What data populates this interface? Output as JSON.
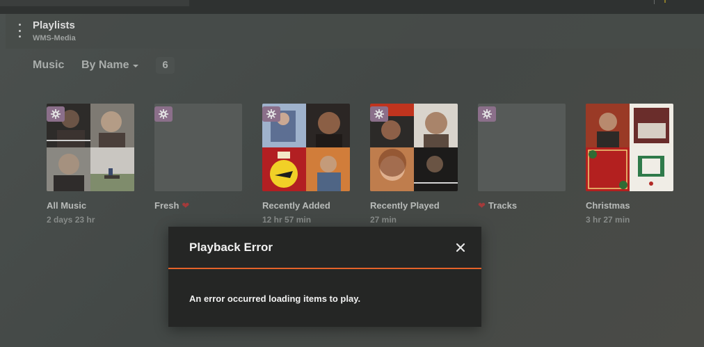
{
  "header": {
    "title": "Playlists",
    "subtitle": "WMS-Media"
  },
  "filter": {
    "section": "Music",
    "sort": "By Name",
    "count": "6"
  },
  "playlists": [
    {
      "title": "All Music",
      "subtitle": "2 days 23 hr",
      "art": "collage"
    },
    {
      "title": "Fresh",
      "subtitle": "",
      "art": "empty",
      "heart": "after"
    },
    {
      "title": "Recently Added",
      "subtitle": "12 hr 57 min",
      "art": "collage"
    },
    {
      "title": "Recently Played",
      "subtitle": "27 min",
      "art": "collage"
    },
    {
      "title": "Tracks",
      "subtitle": "",
      "art": "empty",
      "heart": "before"
    },
    {
      "title": "Christmas",
      "subtitle": "3 hr 27 min",
      "art": "collage"
    }
  ],
  "dialog": {
    "title": "Playback Error",
    "message": "An error occurred loading items to play."
  },
  "icons": {
    "menu": "more-vertical-icon",
    "smart": "gear-icon",
    "heart": "heart-icon",
    "close": "close-icon"
  },
  "colors": {
    "accent": "#e5632a",
    "smart_badge": "#8b6f8a",
    "heart": "#a33a3a",
    "dialog_bg": "#252625"
  }
}
